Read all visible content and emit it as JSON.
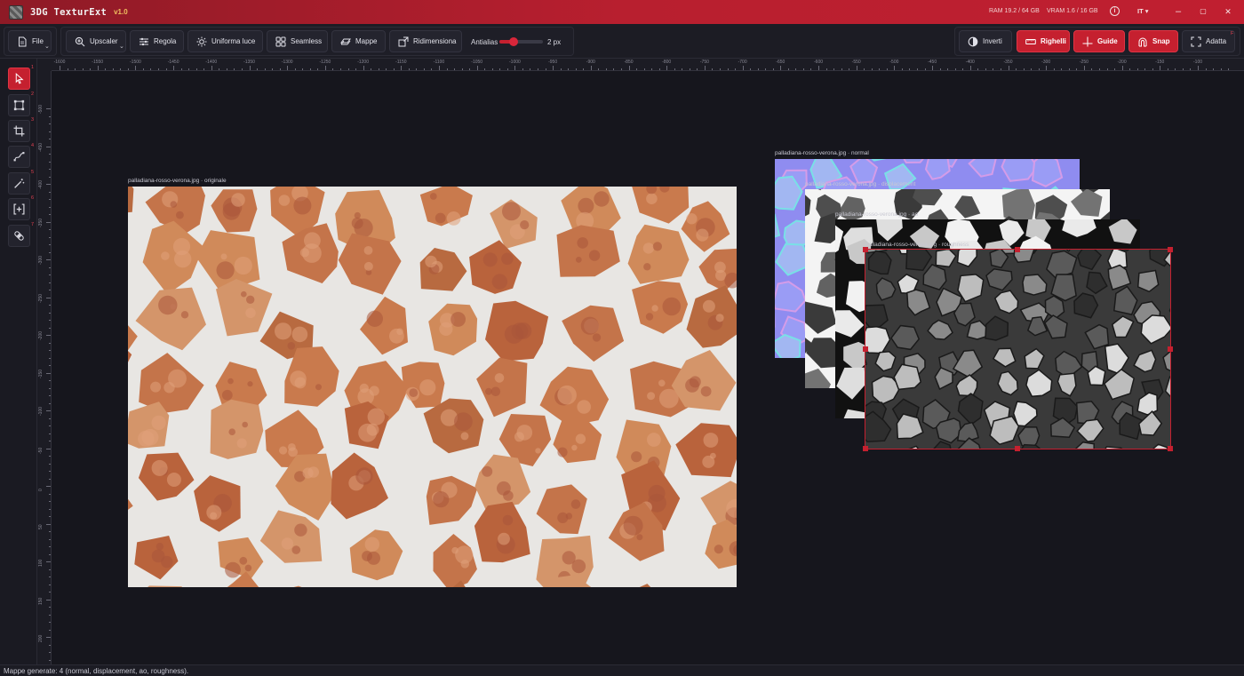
{
  "titlebar": {
    "app_name": "3DG TexturExt",
    "version": "v1.0",
    "ram": "RAM 19.2 / 64 GB",
    "vram": "VRAM 1.6 / 16 GB",
    "info_glyph": "i",
    "language": "IT ▾",
    "minimize_glyph": "–",
    "maximize_glyph": "▢",
    "close_glyph": "✕"
  },
  "toolbar": {
    "file": "File",
    "upscaler": "Upscaler",
    "regola": "Regola",
    "uniforma_luce": "Uniforma luce",
    "seamless": "Seamless",
    "mappe": "Mappe",
    "ridimensiona": "Ridimensiona",
    "antialias_label": "Antialias",
    "antialias_value": "2 px",
    "antialias_level": 0.33,
    "inverti": "Inverti",
    "righelli": "Righelli",
    "guide": "Guide",
    "snap": "Snap",
    "adatta": "Adatta",
    "adatta_key": "F",
    "chevron_glyph": "⌄"
  },
  "tools": [
    {
      "name": "select",
      "key": "1"
    },
    {
      "name": "transform",
      "key": "2"
    },
    {
      "name": "crop",
      "key": "3"
    },
    {
      "name": "warp",
      "key": "4"
    },
    {
      "name": "magic-wand",
      "key": "5"
    },
    {
      "name": "fit",
      "key": "6"
    },
    {
      "name": "patch",
      "key": "7"
    }
  ],
  "ruler": {
    "top_labels": [
      "-1600",
      "-1550",
      "-1500",
      "-1450",
      "-1400",
      "-1350",
      "-1300",
      "-1250",
      "-1200",
      "-1150",
      "-1100",
      "-1050",
      "-1000",
      "-950",
      "-900",
      "-850",
      "-800",
      "-750",
      "-700",
      "-650",
      "-600",
      "-550",
      "-500",
      "-450",
      "-400",
      "-350",
      "-300",
      "-250",
      "-200",
      "-150",
      "-100"
    ],
    "left_labels": [
      "-500",
      "-450",
      "-400",
      "-350",
      "-300",
      "-250",
      "-200",
      "-150",
      "-100",
      "-50",
      "0",
      "50",
      "100",
      "150",
      "200"
    ]
  },
  "layers": {
    "original_caption": "palladiana-rosso-verona.jpg · originale",
    "normal_caption": "palladiana-rosso-verona.jpg · normal",
    "displacement_caption": "palladiana-rosso-verona.jpg · displacement",
    "ao_caption": "palladiana-rosso-verona.jpg · ao",
    "roughness_caption": "palladiana-rosso-verona.jpg · roughness"
  },
  "colors": {
    "accent": "#c5202f",
    "grout": "#e8e6e3",
    "stone": "#c9794d"
  },
  "status": {
    "text": "Mappe generate: 4 (normal, displacement, ao, roughness)."
  }
}
